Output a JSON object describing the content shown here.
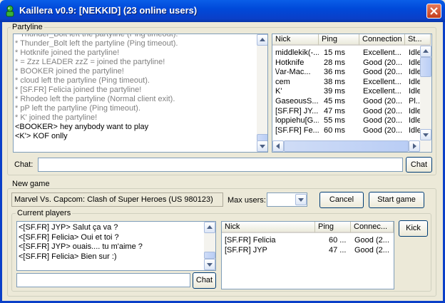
{
  "window": {
    "title": "Kaillera v0.9: [NEKKID] (23 online users)"
  },
  "partyline": {
    "label": "Partyline",
    "messages": [
      {
        "text": "* Thunder_Bolt left the partyline (Ping timeout).",
        "kind": "sys"
      },
      {
        "text": "* Thunder_Bolt left the partyline (Ping timeout).",
        "kind": "sys"
      },
      {
        "text": "* Hotknife joined the partyline!",
        "kind": "sys"
      },
      {
        "text": "* = Zzz LEADER zzZ = joined the partyline!",
        "kind": "sys"
      },
      {
        "text": "* BOOKER joined the partyline!",
        "kind": "sys"
      },
      {
        "text": "* cloud left the partyline (Ping timeout).",
        "kind": "sys"
      },
      {
        "text": "* [SF.FR] Felicia joined the partyline!",
        "kind": "sys"
      },
      {
        "text": "* Rhodeo left the partyline (Normal client exit).",
        "kind": "sys"
      },
      {
        "text": "* pP left the partyline (Ping timeout).",
        "kind": "sys"
      },
      {
        "text": "* K' joined the partyline!",
        "kind": "sys"
      },
      {
        "text": "<BOOKER> hey anybody  want to play",
        "kind": "chat"
      },
      {
        "text": "<K'> KOF onlly",
        "kind": "chat"
      }
    ],
    "chat_label": "Chat:",
    "chat_value": "",
    "chat_button": "Chat"
  },
  "users": {
    "columns": [
      "Nick",
      "Ping",
      "Connection",
      "St..."
    ],
    "rows": [
      [
        "middlekik(-...",
        "15 ms",
        "Excellent...",
        "Idle"
      ],
      [
        "Hotknife",
        "28 ms",
        "Good (20...",
        "Idle"
      ],
      [
        "\\/ar-Mac...",
        "36 ms",
        "Good (20...",
        "Idle"
      ],
      [
        "cem",
        "38 ms",
        "Excellent...",
        "Idle"
      ],
      [
        "K'",
        "39 ms",
        "Excellent...",
        "Idle"
      ],
      [
        "GaseousS...",
        "45 ms",
        "Good (20...",
        "Pl..."
      ],
      [
        "[SF.FR] JY...",
        "47 ms",
        "Good (20...",
        "Idle"
      ],
      [
        "loppiehu[G...",
        "55 ms",
        "Good (20...",
        "Idle"
      ],
      [
        "[SF.FR] Fe...",
        "60 ms",
        "Good (20...",
        "Idle"
      ],
      [
        "...",
        "...",
        "...",
        "..."
      ]
    ]
  },
  "new_game": {
    "label": "New game",
    "game_name": "Marvel Vs. Capcom: Clash of Super Heroes (US 980123)",
    "max_users_label": "Max users:",
    "max_users_value": "",
    "cancel_button": "Cancel",
    "start_button": "Start game"
  },
  "current_players": {
    "label": "Current players",
    "messages": [
      "<[SF.FR] JYP> Salut ça va ?",
      "<[SF.FR] Felicia> Oui et toi ?",
      "<[SF.FR] JYP> ouais.... tu m'aime ?",
      "<[SF.FR] Felicia> Bien sur :)"
    ],
    "chat_value": "",
    "chat_button": "Chat",
    "kick_button": "Kick",
    "columns": [
      "Nick",
      "Ping",
      "Connec..."
    ],
    "rows": [
      [
        "[SF.FR] Felicia",
        "60 ...",
        "Good (2..."
      ],
      [
        "[SF.FR] JYP",
        "47 ...",
        "Good (2..."
      ]
    ]
  },
  "colors": {
    "titlebar": "#0a3fc8",
    "system_text": "#808080",
    "window_bg": "#ece9d8"
  }
}
